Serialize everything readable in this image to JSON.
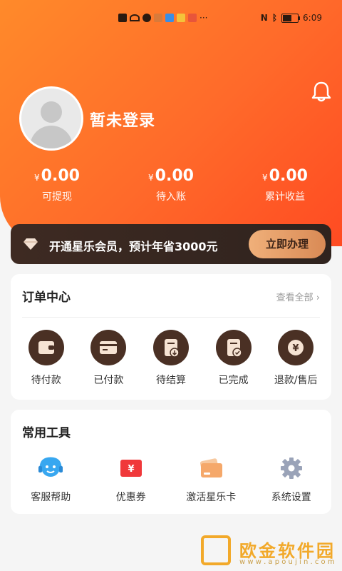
{
  "status_bar": {
    "time": "6:09",
    "battery_level": "59",
    "battery_fraction": 0.59
  },
  "profile": {
    "login_text": "暂未登录"
  },
  "stats": [
    {
      "currency": "¥",
      "value": "0.00",
      "label": "可提现"
    },
    {
      "currency": "¥",
      "value": "0.00",
      "label": "待入账"
    },
    {
      "currency": "¥",
      "value": "0.00",
      "label": "累计收益"
    }
  ],
  "vip_banner": {
    "text": "开通星乐会员，预计年省3000元",
    "button": "立即办理"
  },
  "orders": {
    "title": "订单中心",
    "view_all": "查看全部",
    "items": [
      {
        "label": "待付款",
        "icon": "wallet-icon"
      },
      {
        "label": "已付款",
        "icon": "card-icon"
      },
      {
        "label": "待结算",
        "icon": "document-download-icon"
      },
      {
        "label": "已完成",
        "icon": "document-check-icon"
      },
      {
        "label": "退款/售后",
        "icon": "yuan-refund-icon"
      }
    ]
  },
  "tools": {
    "title": "常用工具",
    "items": [
      {
        "label": "客服帮助",
        "icon": "customer-service-icon"
      },
      {
        "label": "优惠券",
        "icon": "coupon-icon"
      },
      {
        "label": "激活星乐卡",
        "icon": "member-card-icon"
      },
      {
        "label": "系统设置",
        "icon": "gear-icon"
      }
    ]
  },
  "watermark": {
    "name": "欧金软件园",
    "url": "w w w . a p o u j i n . c o m"
  },
  "colors": {
    "hero_start": "#ff8a2a",
    "hero_end": "#ff4b22",
    "vip_bg": "#3e2a22",
    "vip_button": "#e9a06b",
    "order_icon_bg": "#4a3024",
    "watermark": "#f2a92a"
  }
}
